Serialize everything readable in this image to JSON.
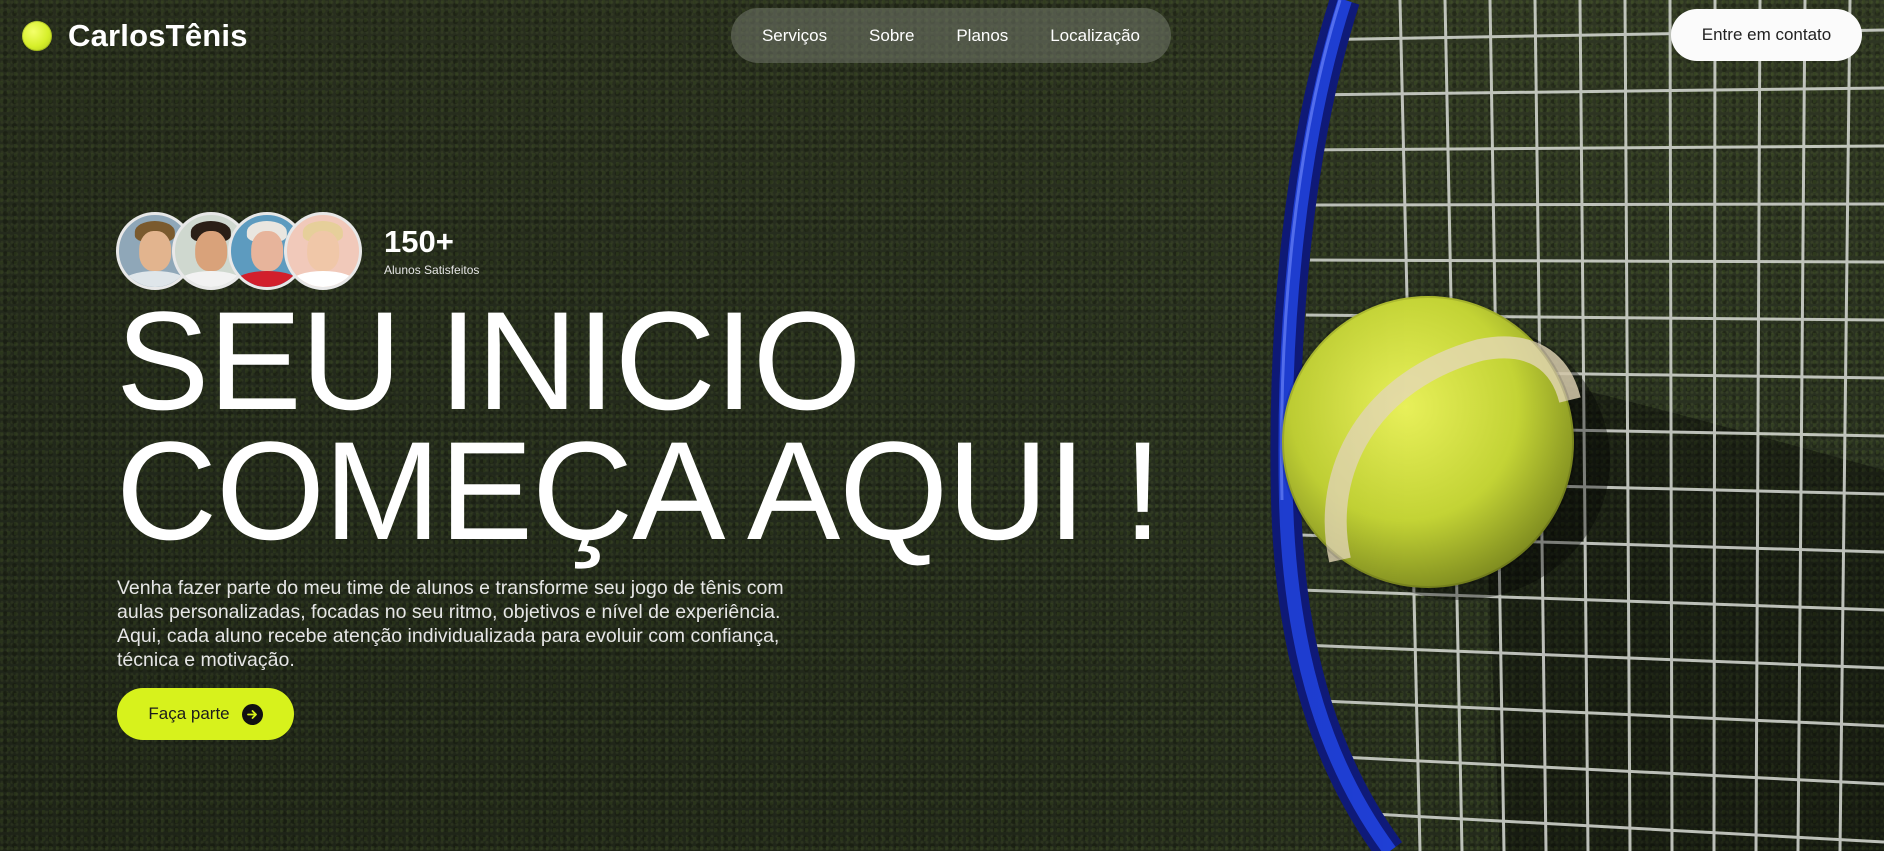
{
  "brand": {
    "name": "CarlosTênis",
    "logo_icon": "tennis-ball-icon",
    "accent": "#d7f21c"
  },
  "nav": {
    "items": [
      {
        "label": "Serviços"
      },
      {
        "label": "Sobre"
      },
      {
        "label": "Planos"
      },
      {
        "label": "Localização"
      }
    ],
    "contact_label": "Entre em contato"
  },
  "students": {
    "count": "150+",
    "label": "Alunos Satisfeitos",
    "avatars": [
      "avatar-student-1",
      "avatar-student-2",
      "avatar-student-3",
      "avatar-student-4"
    ]
  },
  "hero": {
    "title_line1": "SEU INICIO",
    "title_line2": "COMEÇA AQUI !",
    "description": "Venha fazer parte do meu time de alunos e transforme seu jogo de tênis com aulas personalizadas, focadas no seu ritmo, objetivos e nível de experiência. Aqui, cada aluno recebe atenção individualizada para evoluir com confiança, técnica e motivação.",
    "cta_label": "Faça parte",
    "cta_icon": "arrow-right-icon"
  }
}
